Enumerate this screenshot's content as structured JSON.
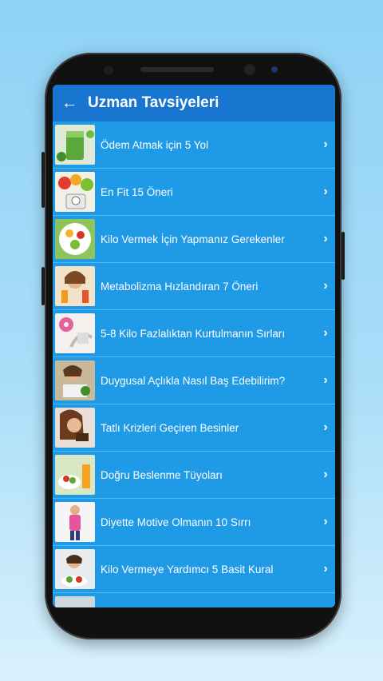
{
  "header": {
    "title": "Uzman Tavsiyeleri",
    "back_icon": "arrow-left-icon"
  },
  "colors": {
    "appbar": "#1876d1",
    "list_bg": "#1f9ae6",
    "divider": "#53b7f1"
  },
  "items": [
    {
      "label": "Ödem Atmak için 5 Yol",
      "thumb": "green-smoothie"
    },
    {
      "label": "En Fit 15 Öneri",
      "thumb": "fruits-scale"
    },
    {
      "label": "Kilo Vermek İçin Yapmanız Gerekenler",
      "thumb": "fruit-plate"
    },
    {
      "label": "Metabolizma Hızlandıran 7 Öneri",
      "thumb": "woman-juice"
    },
    {
      "label": "5-8 Kilo Fazlalıktan Kurtulmanın Sırları",
      "thumb": "donut-measure"
    },
    {
      "label": "Duygusal Açlıkla Nasıl Baş Edebilirim?",
      "thumb": "woman-eating"
    },
    {
      "label": "Tatlı Krizleri Geçiren Besinler",
      "thumb": "woman-chocolate"
    },
    {
      "label": "Doğru Beslenme Tüyoları",
      "thumb": "salad-juice"
    },
    {
      "label": "Diyette Motive Olmanın 10 Sırrı",
      "thumb": "woman-pink"
    },
    {
      "label": "Kilo Vermeye Yardımcı 5 Basit Kural",
      "thumb": "woman-salad"
    },
    {
      "label": "",
      "thumb": "partial-row"
    }
  ]
}
